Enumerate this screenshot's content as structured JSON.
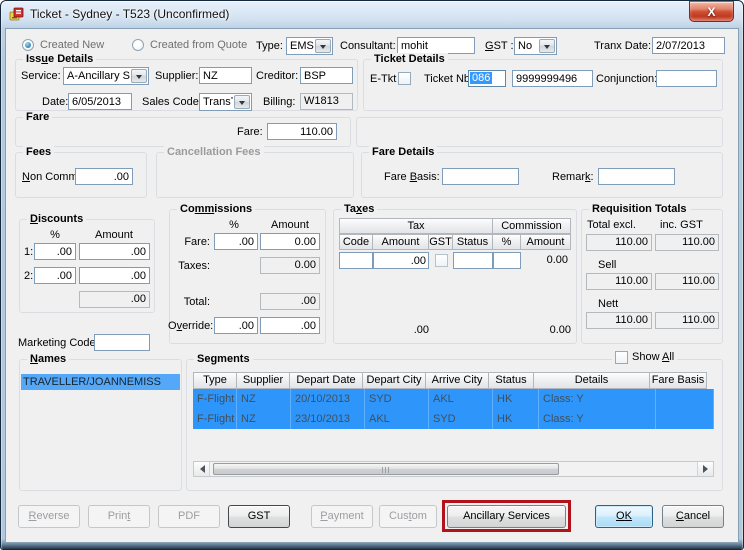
{
  "window": {
    "title": "Ticket - Sydney - T523 (Unconfirmed)"
  },
  "icons": {
    "close": "X",
    "dropdown": "down-arrow-triangle",
    "scroll_left": "left-arrow-triangle",
    "scroll_right": "right-arrow-triangle",
    "app": "ticket-app-icon"
  },
  "colors": {
    "selection_blue": "#2e95fb",
    "names_selection_blue": "#55a8f7",
    "text_selection_blue": "#3399ff",
    "annotation_red": "#b1121b",
    "default_button_blue": "#bfe6fb",
    "close_button_red": "#c03a22"
  },
  "header": {
    "created_new": "Created New",
    "created_from_quote": "Created from Quote",
    "type_label": "Type:",
    "type_value": "EMS",
    "consultant_label": "Consultant:",
    "consultant_value": "mohit",
    "gst_label": "GST :",
    "gst_value": "No",
    "tranx_date_label": "Tranx Date:",
    "tranx_date_value": "2/07/2013"
  },
  "issue_details": {
    "title": "Issue Details",
    "service_label": "Service:",
    "service_value": "A-Ancillary S",
    "supplier_label": "Supplier:",
    "supplier_value": "NZ",
    "creditor_label": "Creditor:",
    "creditor_value": "BSP",
    "date_label": "Date:",
    "date_value": "6/05/2013",
    "sales_code_label": "Sales Code:",
    "sales_code_value": "TransTa",
    "billing_label": "Billing:",
    "billing_value": "W1813"
  },
  "ticket_details": {
    "title": "Ticket Details",
    "etkt_label": "E-Tkt",
    "ticket_nbr_label": "Ticket Nbr:",
    "ticket_nbr_airline": "086",
    "ticket_nbr_value": "9999999496",
    "conjunction_label": "Conjunction:",
    "conjunction_value": ""
  },
  "fare": {
    "title": "Fare",
    "fare_label": "Fare:",
    "fare_value": "110.00"
  },
  "fees": {
    "title": "Fees",
    "non_comm_label": "Non Comm:",
    "non_comm_value": ".00"
  },
  "cancellation_fees": {
    "title": "Cancellation Fees"
  },
  "fare_details": {
    "title": "Fare Details",
    "fare_basis_label": "Fare Basis:",
    "fare_basis_value": "",
    "remark_label": "Remark:",
    "remark_value": ""
  },
  "discounts": {
    "title": "Discounts",
    "pct_header": "%",
    "amount_header": "Amount",
    "rows": [
      {
        "label": "1:",
        "pct": ".00",
        "amount": ".00"
      },
      {
        "label": "2:",
        "pct": ".00",
        "amount": ".00"
      }
    ],
    "total": ".00"
  },
  "marketing": {
    "label": "Marketing Code:",
    "value": ""
  },
  "commissions": {
    "title": "Commissions",
    "pct_header": "%",
    "amount_header": "Amount",
    "fare_label": "Fare:",
    "fare_pct": ".00",
    "fare_amount": "0.00",
    "taxes_label": "Taxes:",
    "taxes_amount": "0.00",
    "total_label": "Total:",
    "total_amount": ".00",
    "override_label": "Override:",
    "override_pct": ".00",
    "override_amount": ".00"
  },
  "taxes": {
    "title": "Taxes",
    "tax_group_header": "Tax",
    "commission_group_header": "Commission",
    "col_headers": [
      "Code",
      "Amount",
      "GST",
      "Status",
      "%",
      "Amount"
    ],
    "row": {
      "code": "",
      "amount": ".00",
      "status": "",
      "pct": "",
      "commission_amount": "0.00"
    },
    "total_tax": ".00",
    "total_commission": "0.00"
  },
  "requisition_totals": {
    "title": "Requisition Totals",
    "excl_header": "Total excl.",
    "incl_header": "inc. GST",
    "total_excl": "110.00",
    "total_incl": "110.00",
    "sell_label": "Sell",
    "sell_excl": "110.00",
    "sell_incl": "110.00",
    "nett_label": "Nett",
    "nett_excl": "110.00",
    "nett_incl": "110.00"
  },
  "names": {
    "title": "Names",
    "items": [
      "TRAVELLER/JOANNEMISS"
    ]
  },
  "segments": {
    "title": "Segments",
    "show_all_label": "Show All",
    "columns": [
      "Type",
      "Supplier",
      "Depart Date",
      "Depart City",
      "Arrive City",
      "Status",
      "Details",
      "Fare Basis"
    ],
    "rows": [
      {
        "type": "F-Flight",
        "supplier": "NZ",
        "depart_date": "20/10/2013",
        "depart_city": "SYD",
        "arrive_city": "AKL",
        "status": "HK",
        "details": "Class: Y",
        "fare_basis": ""
      },
      {
        "type": "F-Flight",
        "supplier": "NZ",
        "depart_date": "23/10/2013",
        "depart_city": "AKL",
        "arrive_city": "SYD",
        "status": "HK",
        "details": "Class: Y",
        "fare_basis": ""
      }
    ]
  },
  "footer": {
    "reverse": "Reverse",
    "print": "Print",
    "pdf": "PDF",
    "gst": "GST",
    "payment": "Payment",
    "custom": "Custom",
    "ancillary": "Ancillary Services",
    "ok": "OK",
    "cancel": "Cancel"
  }
}
